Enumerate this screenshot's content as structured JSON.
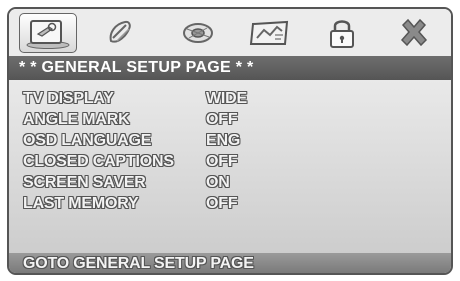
{
  "tabs": [
    {
      "icon": "general-setup-icon",
      "active": true
    },
    {
      "icon": "audio-setup-icon",
      "active": false
    },
    {
      "icon": "video-setup-icon",
      "active": false
    },
    {
      "icon": "preference-icon",
      "active": false
    },
    {
      "icon": "password-lock-icon",
      "active": false
    },
    {
      "icon": "exit-icon",
      "active": false
    }
  ],
  "header": {
    "title": "* * GENERAL SETUP PAGE * *"
  },
  "settings": [
    {
      "label": "TV DISPLAY",
      "value": "WIDE"
    },
    {
      "label": "ANGLE MARK",
      "value": "OFF"
    },
    {
      "label": "OSD LANGUAGE",
      "value": "ENG"
    },
    {
      "label": "CLOSED CAPTIONS",
      "value": "OFF"
    },
    {
      "label": "SCREEN SAVER",
      "value": "ON"
    },
    {
      "label": "LAST MEMORY",
      "value": "OFF"
    }
  ],
  "footer": {
    "status": "GOTO GENERAL SETUP PAGE"
  },
  "colors": {
    "header_bar": "#5f5f5f",
    "panel": "#dcdcdc",
    "footer_bar": "#888888"
  }
}
